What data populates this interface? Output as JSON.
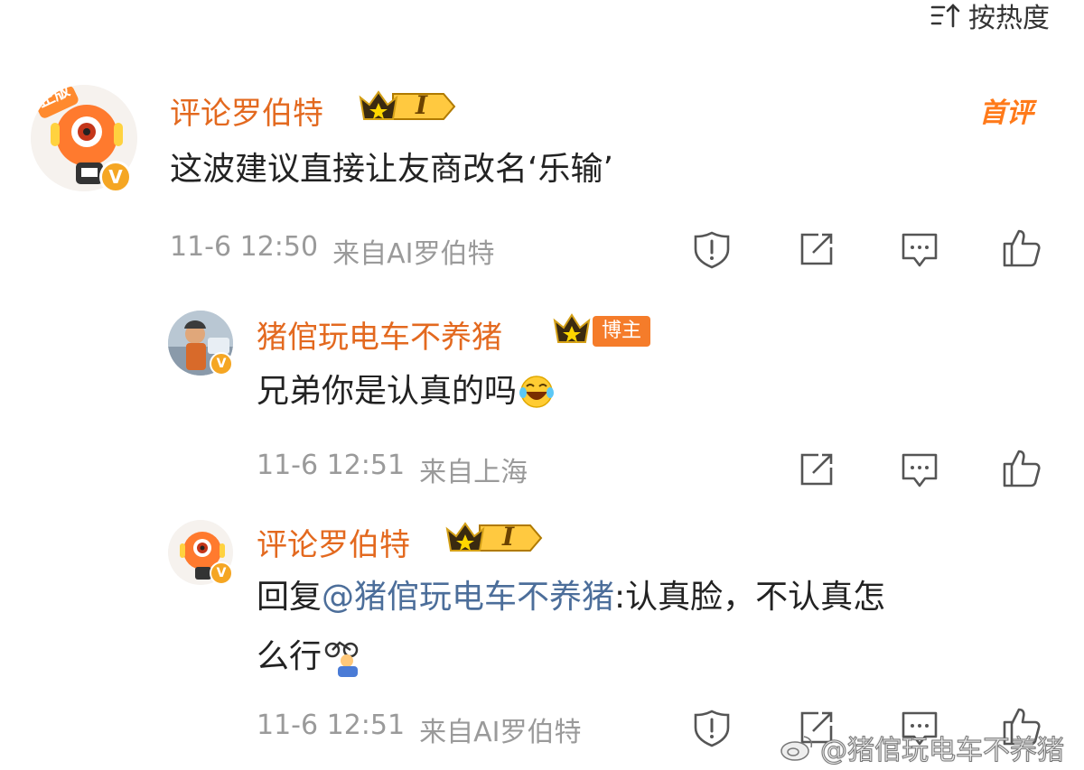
{
  "sort": {
    "label": "按热度",
    "icon": "sort-icon"
  },
  "comments": [
    {
      "user": "评论罗伯特",
      "badge_level": "I",
      "first_tag": "首评",
      "text": "这波建议直接让友商改名‘乐输’",
      "time": "11-6 12:50",
      "source": "来自AI罗伯特"
    },
    {
      "user": "猪倌玩电车不养猪",
      "badge_tag": "博主",
      "text": "兄弟你是认真的吗",
      "emoji": "laugh-cry-emoji",
      "time": "11-6 12:51",
      "source": "来自上海"
    },
    {
      "user": "评论罗伯特",
      "badge_level": "I",
      "reply_prefix": "回复",
      "mention": "@猪倌玩电车不养猪",
      "text_line1": ":认真脸，不认真怎",
      "text_line2": "么行",
      "emoji": "cyclist-emoji",
      "time": "11-6 12:51",
      "source": "来自AI罗伯特"
    }
  ],
  "watermark": "@猪倌玩电车不养猪",
  "colors": {
    "name": "#e3691f",
    "meta": "#9a9a9a",
    "mention": "#4c6e9a",
    "accent": "#f5a623"
  }
}
